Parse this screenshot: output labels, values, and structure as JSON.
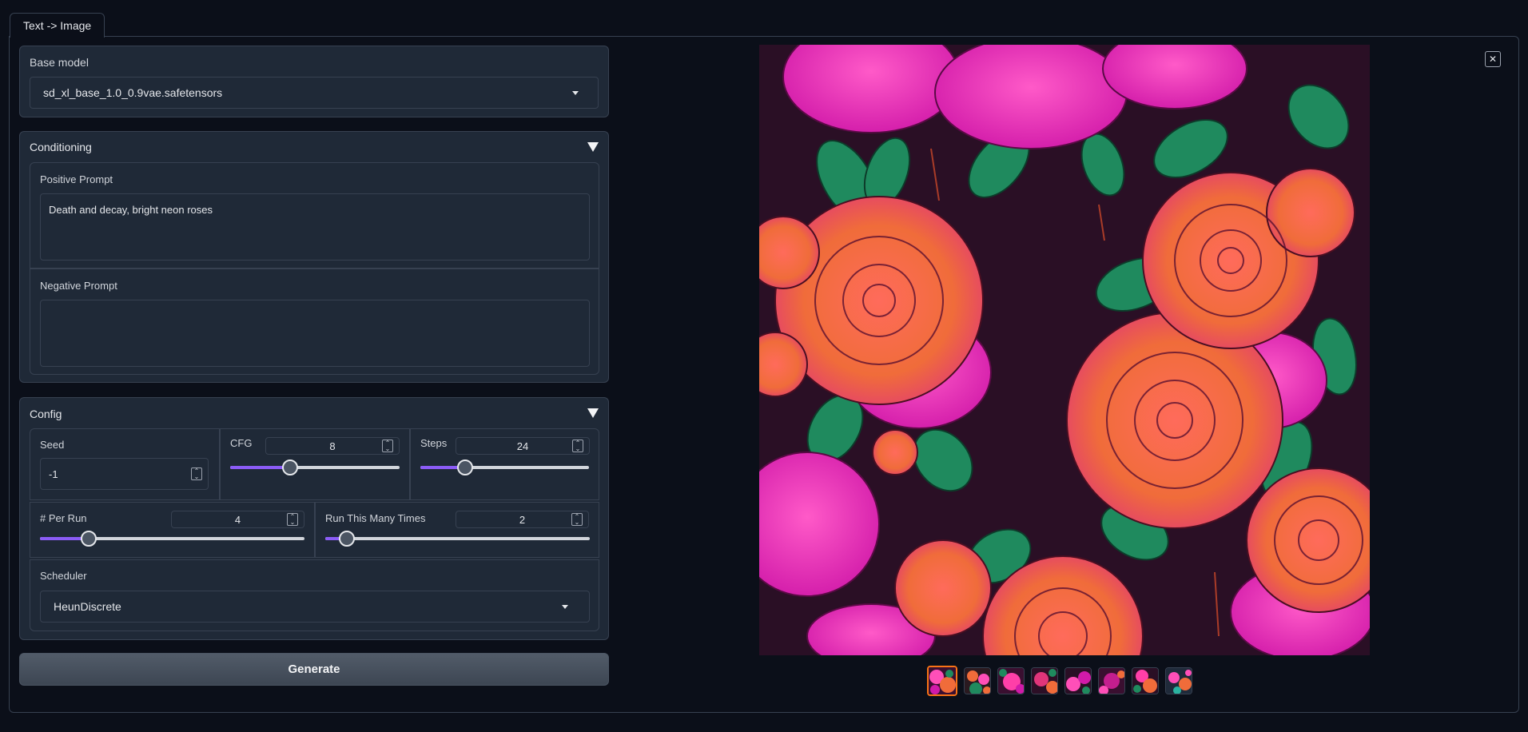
{
  "tabs": [
    {
      "label": "Text -> Image",
      "active": true
    }
  ],
  "base_model": {
    "label": "Base model",
    "value": "sd_xl_base_1.0_0.9vae.safetensors"
  },
  "conditioning": {
    "title": "Conditioning",
    "positive": {
      "label": "Positive Prompt",
      "value": "Death and decay, bright neon roses"
    },
    "negative": {
      "label": "Negative Prompt",
      "value": ""
    }
  },
  "config": {
    "title": "Config",
    "seed": {
      "label": "Seed",
      "value": "-1"
    },
    "cfg": {
      "label": "CFG",
      "value": "8",
      "fraction": 0.35
    },
    "steps": {
      "label": "Steps",
      "value": "24",
      "fraction": 0.26
    },
    "per_run": {
      "label": "# Per Run",
      "value": "4",
      "fraction": 0.18
    },
    "run_times": {
      "label": "Run This Many Times",
      "value": "2",
      "fraction": 0.08
    },
    "scheduler": {
      "label": "Scheduler",
      "value": "HeunDiscrete"
    }
  },
  "generate_label": "Generate",
  "close_label": "✕",
  "gallery": {
    "count": 8,
    "selected_index": 0
  },
  "colors": {
    "accent": "#8b5cf6",
    "selected": "#f97316",
    "bg": "#0b0f19",
    "panel": "#1f2937"
  }
}
